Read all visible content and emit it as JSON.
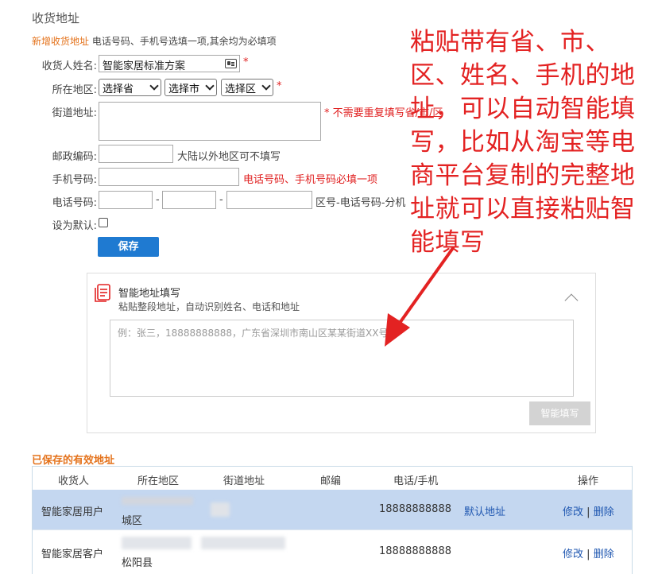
{
  "page": {
    "section_title": "收货地址",
    "subheader_orange": "新增收货地址",
    "subheader_rest": "电话号码、手机号选填一项,其余均为必填项"
  },
  "form": {
    "name_label": "收货人姓名:",
    "name_value": "智能家居标准方案",
    "region_label": "所在地区:",
    "province": "选择省",
    "city": "选择市",
    "district": "选择区",
    "street_label": "街道地址:",
    "street_note": "* 不需要重复填写省/市/区",
    "postal_label": "邮政编码:",
    "postal_note": "大陆以外地区可不填写",
    "mobile_label": "手机号码:",
    "mobile_note": "电话号码、手机号码必填一项",
    "phone_label": "电话号码:",
    "phone_note": "区号-电话号码-分机",
    "default_label": "设为默认:",
    "save_label": "保存",
    "required_mark": "*",
    "dash": "-"
  },
  "smart_panel": {
    "title": "智能地址填写",
    "subtitle": "粘贴整段地址，自动识别姓名、电话和地址",
    "placeholder": "例：张三，18888888888，广东省深圳市南山区某某街道XX号",
    "button": "智能填写"
  },
  "saved": {
    "title": "已保存的有效地址",
    "headers": [
      "收货人",
      "所在地区",
      "街道地址",
      "邮编",
      "电话/手机",
      "操作"
    ],
    "rows": [
      {
        "name": "智能家居用户",
        "region_tail": "城区",
        "phone": "18888888888",
        "default": "默认地址",
        "edit": "修改",
        "sep": "|",
        "delete": "删除"
      },
      {
        "name": "智能家居客户",
        "region_tail": "松阳县",
        "phone": "18888888888",
        "edit": "修改",
        "sep": "|",
        "delete": "删除"
      }
    ]
  },
  "annotation": {
    "text": "粘贴带有省、市、区、姓名、手机的地址，可以自动智能填写，比如从淘宝等电商平台复制的完整地址就可以直接粘贴智能填写",
    "color": "#e32222"
  },
  "colors": {
    "accent": "#1f7ad1",
    "orange": "#e4721b",
    "required": "#e02020",
    "selected_row": "#c4d7f0"
  }
}
